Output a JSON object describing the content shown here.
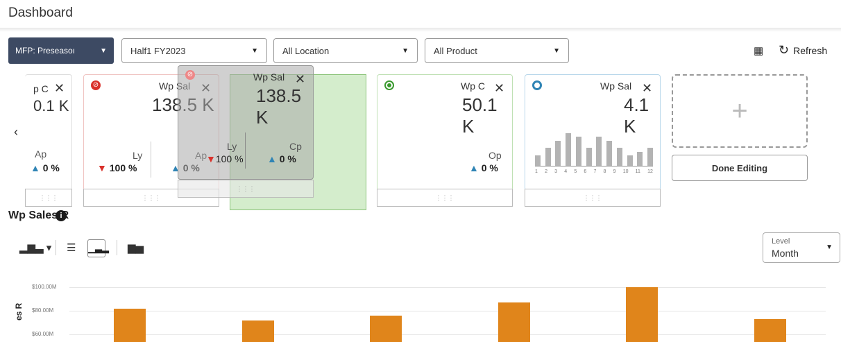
{
  "page": {
    "title": "Dashboard"
  },
  "filters": {
    "scenario": "MFP: Preseasoı",
    "period": "Half1 FY2023",
    "location": "All Location",
    "product": "All Product"
  },
  "toolbar": {
    "refresh_label": "Refresh"
  },
  "tiles": [
    {
      "name": "p C",
      "value": "0.1 K",
      "metrics": [
        {
          "label": "Ap",
          "pct": "0 %",
          "dir": "up"
        }
      ]
    },
    {
      "name": "Wp Sal",
      "value": "138.5 K",
      "status": "error",
      "metrics": [
        {
          "label": "Ly",
          "pct": "100 %",
          "dir": "down"
        },
        {
          "label": "Ap",
          "pct": "0 %",
          "dir": "up"
        }
      ]
    },
    {
      "name": "Wp Sal",
      "value": "138.5 K",
      "status": "error",
      "metrics": [
        {
          "label": "Ly",
          "pct": "100 %",
          "dir": "down"
        },
        {
          "label": "Cp",
          "pct": "0 %",
          "dir": "up"
        }
      ]
    },
    {
      "name": "Wp C",
      "value": "50.1 K",
      "status": "ok",
      "metrics": [
        {
          "label": "Op",
          "pct": "0 %",
          "dir": "up"
        }
      ]
    },
    {
      "name": "Wp Sal",
      "value": "4.1 K",
      "status": "neutral",
      "sparkline": {
        "labels": [
          "1",
          "2",
          "3",
          "4",
          "5",
          "6",
          "7",
          "8",
          "9",
          "10",
          "11",
          "12"
        ],
        "values": [
          3,
          5,
          7,
          9,
          8,
          5,
          8,
          7,
          5,
          3,
          4,
          5
        ]
      }
    }
  ],
  "edit": {
    "add_symbol": "+",
    "done_label": "Done Editing"
  },
  "chart_header": {
    "title": "Wp Sales R",
    "info": "i"
  },
  "level": {
    "label": "Level",
    "value": "Month"
  },
  "chart_data": {
    "type": "bar",
    "ylabel": "es R",
    "yticks": [
      "$100.00M",
      "$80.00M",
      "$60.00M"
    ],
    "ylim": [
      50,
      100
    ],
    "values": [
      82,
      72,
      76,
      87,
      100,
      73
    ]
  },
  "colors": {
    "bar": "#e0851b",
    "accent": "#3d4a63",
    "ok": "#3a9a2e",
    "error": "#d9312b",
    "neutral": "#2f84b5"
  }
}
